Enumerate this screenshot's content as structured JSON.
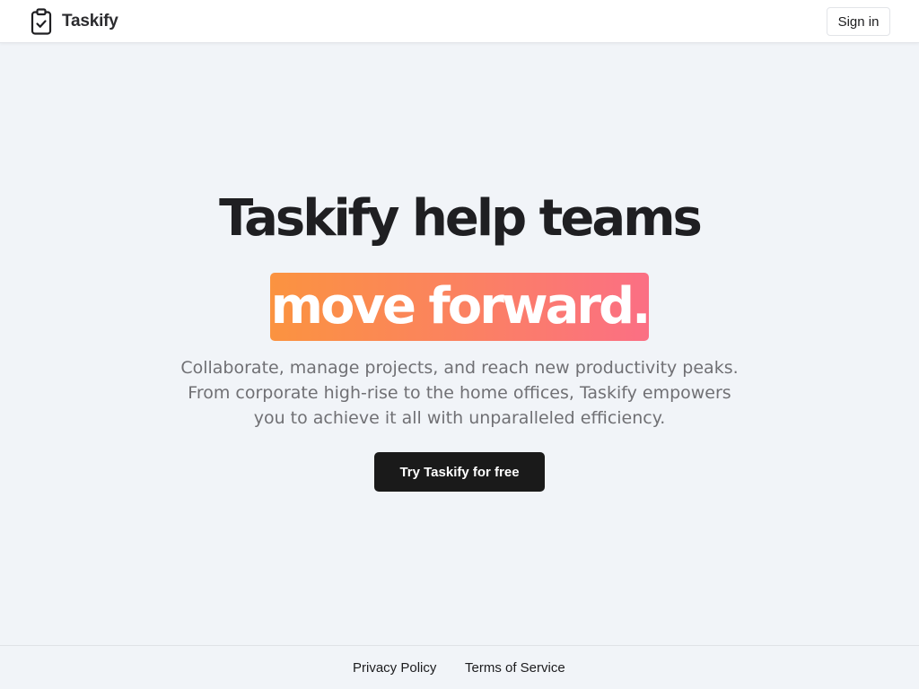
{
  "navbar": {
    "brand_name": "Taskify",
    "brand_icon": "clipboard-check-icon",
    "signin_label": "Sign in"
  },
  "hero": {
    "title": "Taskify help teams",
    "highlight": "move forward.",
    "highlight_gradient": [
      "#fb9340",
      "#fb6f84"
    ],
    "subtitle_lines": [
      "Collaborate, manage projects, and reach new productivity peaks.",
      "From corporate high-rise to the home offices, Taskify empowers",
      "you to achieve it all with unparalleled efficiency."
    ],
    "cta_label": "Try Taskify for free"
  },
  "footer": {
    "privacy_label": "Privacy Policy",
    "terms_label": "Terms of Service"
  },
  "colors": {
    "background": "#f1f4f8",
    "text_dark": "#1f1f22",
    "text_muted": "#707074",
    "button_dark": "#1a1a1a"
  }
}
